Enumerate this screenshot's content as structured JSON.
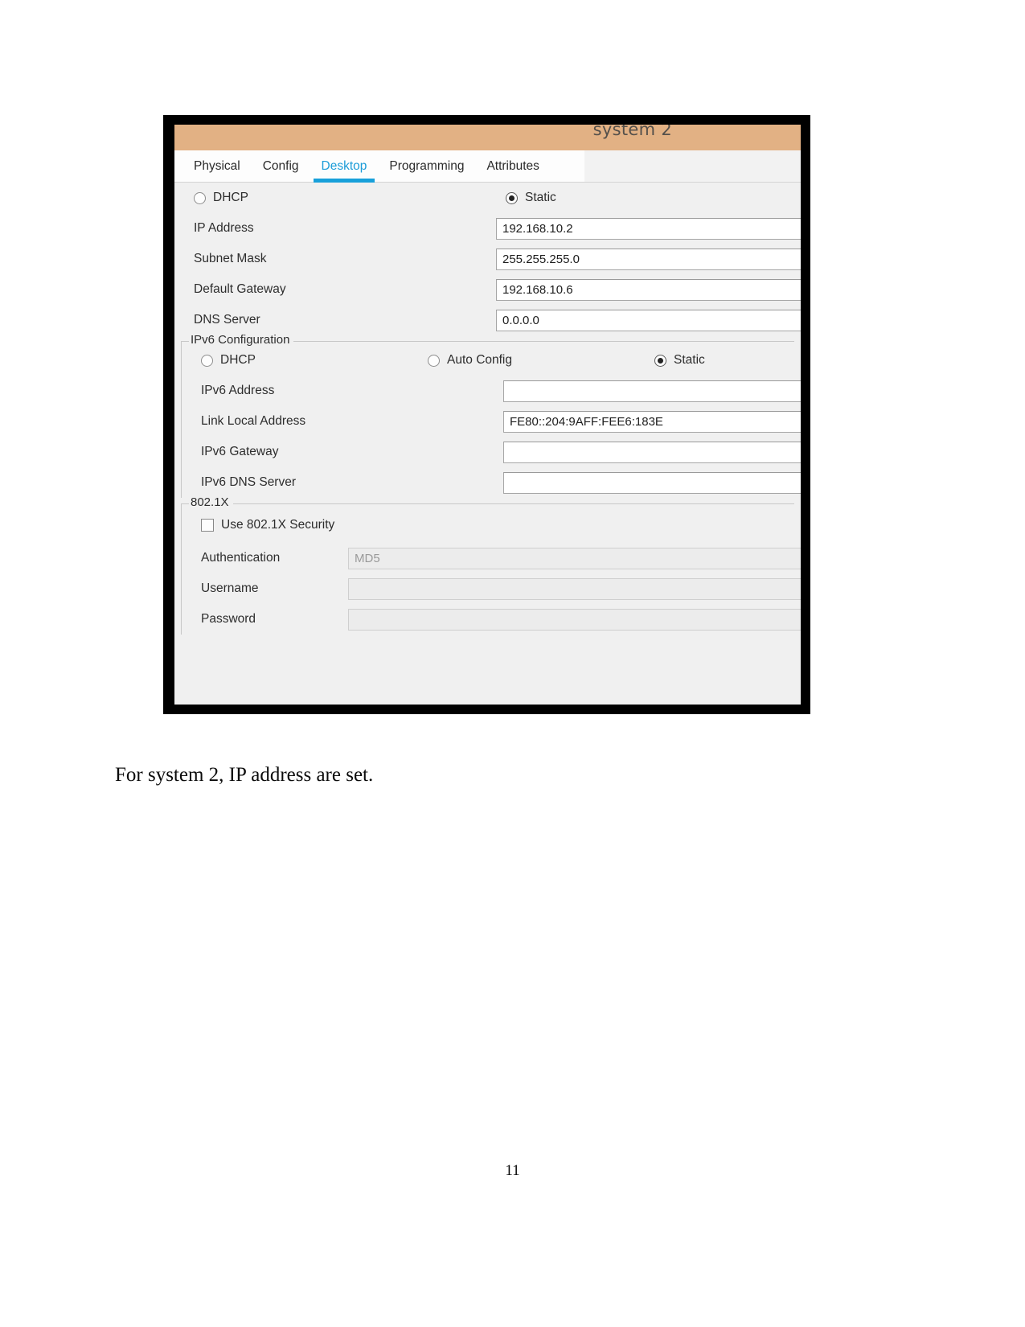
{
  "document": {
    "caption": "For system 2, IP address are set.",
    "page_number": "11"
  },
  "window": {
    "title": "system 2",
    "titlebar_color": "#e2b184",
    "accent_color": "#18a0da",
    "tabs": [
      {
        "label": "Physical",
        "active": false
      },
      {
        "label": "Config",
        "active": false
      },
      {
        "label": "Desktop",
        "active": true
      },
      {
        "label": "Programming",
        "active": false
      },
      {
        "label": "Attributes",
        "active": false
      }
    ]
  },
  "ip_configuration": {
    "mode_options": [
      {
        "label": "DHCP",
        "selected": false
      },
      {
        "label": "Static",
        "selected": true
      }
    ],
    "fields": [
      {
        "label": "IP Address",
        "value": "192.168.10.2"
      },
      {
        "label": "Subnet Mask",
        "value": "255.255.255.0"
      },
      {
        "label": "Default Gateway",
        "value": "192.168.10.6"
      },
      {
        "label": "DNS Server",
        "value": "0.0.0.0"
      }
    ]
  },
  "ipv6_configuration": {
    "group_title": "IPv6 Configuration",
    "mode_options": [
      {
        "label": "DHCP",
        "selected": false
      },
      {
        "label": "Auto Config",
        "selected": false
      },
      {
        "label": "Static",
        "selected": true
      }
    ],
    "fields": [
      {
        "label": "IPv6 Address",
        "value": ""
      },
      {
        "label": "Link Local Address",
        "value": "FE80::204:9AFF:FEE6:183E"
      },
      {
        "label": "IPv6 Gateway",
        "value": ""
      },
      {
        "label": "IPv6 DNS Server",
        "value": ""
      }
    ]
  },
  "dot1x": {
    "group_title": "802.1X",
    "checkbox_label": "Use 802.1X Security",
    "checked": false,
    "fields": [
      {
        "label": "Authentication",
        "value": "MD5",
        "disabled": true
      },
      {
        "label": "Username",
        "value": "",
        "disabled": true
      },
      {
        "label": "Password",
        "value": "",
        "disabled": true
      }
    ]
  }
}
